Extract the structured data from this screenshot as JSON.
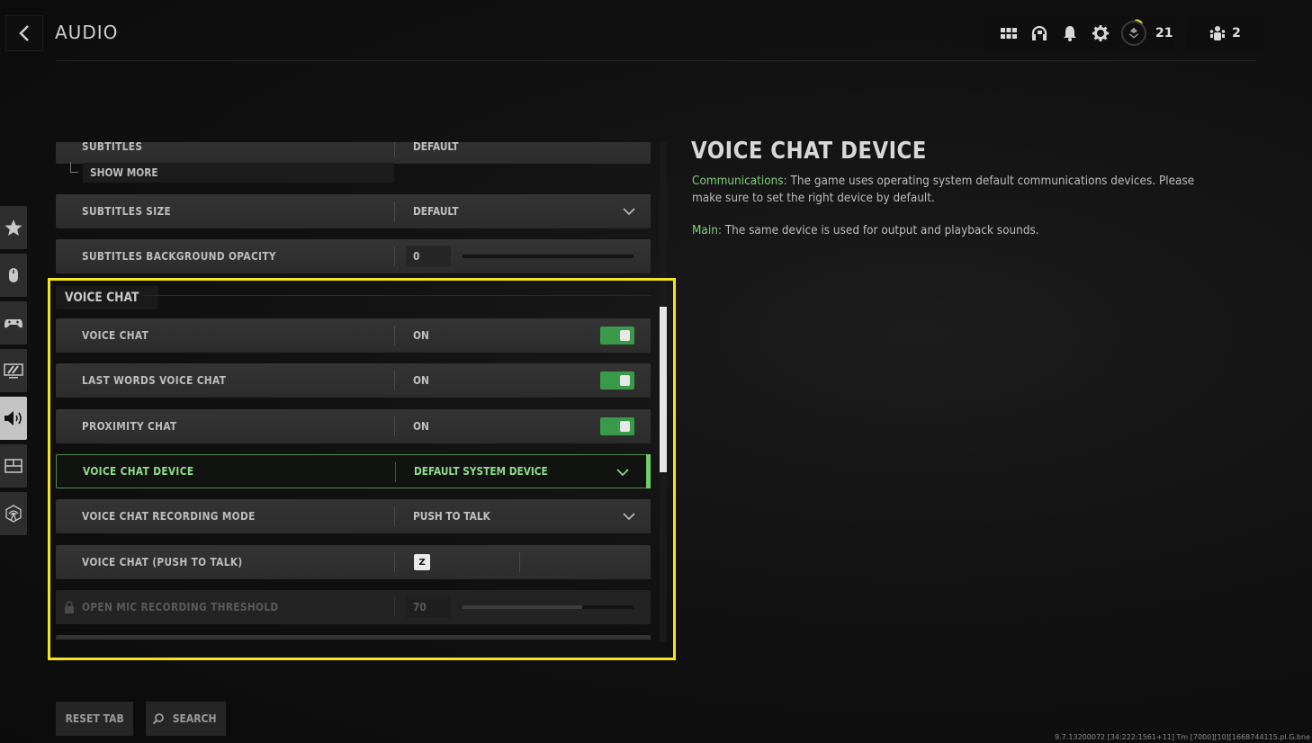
{
  "header": {
    "title": "AUDIO",
    "rank_level": "21",
    "party_count": "2",
    "icons": [
      "grid-menu-icon",
      "headset-icon",
      "bell-icon",
      "gear-icon",
      "rank-badge-icon",
      "party-icon"
    ]
  },
  "rail": {
    "items": [
      {
        "name": "favorites",
        "icon": "star-icon"
      },
      {
        "name": "mouse",
        "icon": "mouse-icon"
      },
      {
        "name": "controller",
        "icon": "gamepad-icon"
      },
      {
        "name": "graphics",
        "icon": "monitor-icon"
      },
      {
        "name": "audio",
        "icon": "speaker-icon",
        "active": true
      },
      {
        "name": "interface",
        "icon": "layout-icon"
      },
      {
        "name": "account-network",
        "icon": "network-icon"
      }
    ]
  },
  "settings": {
    "cut_row_label": "SUBTITLES",
    "cut_row_value": "DEFAULT",
    "show_more": "SHOW MORE",
    "subtitles_size": {
      "label": "SUBTITLES SIZE",
      "value": "DEFAULT"
    },
    "subtitles_bg_opacity": {
      "label": "SUBTITLES BACKGROUND OPACITY",
      "value": "0",
      "fraction": 0.0
    },
    "section_voice_chat": "VOICE CHAT",
    "voice_chat": {
      "label": "VOICE CHAT",
      "value": "ON",
      "on": true
    },
    "last_words": {
      "label": "LAST WORDS VOICE CHAT",
      "value": "ON",
      "on": true
    },
    "proximity": {
      "label": "PROXIMITY CHAT",
      "value": "ON",
      "on": true
    },
    "device": {
      "label": "VOICE CHAT DEVICE",
      "value": "DEFAULT SYSTEM DEVICE"
    },
    "recording_mode": {
      "label": "VOICE CHAT RECORDING MODE",
      "value": "PUSH TO TALK"
    },
    "push_to_talk": {
      "label": "VOICE CHAT (PUSH TO TALK)",
      "key": "Z"
    },
    "open_mic": {
      "label": "OPEN MIC RECORDING THRESHOLD",
      "value": "70",
      "fraction": 0.7,
      "locked": true
    }
  },
  "scrollbar": {
    "thumb_start_fraction": 0.33,
    "thumb_size_fraction": 0.33
  },
  "description": {
    "title": "VOICE CHAT DEVICE",
    "p1_key": "Communications:",
    "p1_text": " The game uses operating system default communications devices. Please make sure to set the right device by default.",
    "p2_key": "Main:",
    "p2_text": " The same device is used for output and playback sounds."
  },
  "footer": {
    "reset_tab": "RESET TAB",
    "search": "SEARCH",
    "build": "9.7.13200072 [34:222:1561+11] Tm [7000][10][1668744115.pl.G.bne"
  },
  "colors": {
    "accent_green": "#7fcf7a",
    "toggle_green": "#3a9a4a",
    "highlight_yellow": "#f5e51f"
  }
}
